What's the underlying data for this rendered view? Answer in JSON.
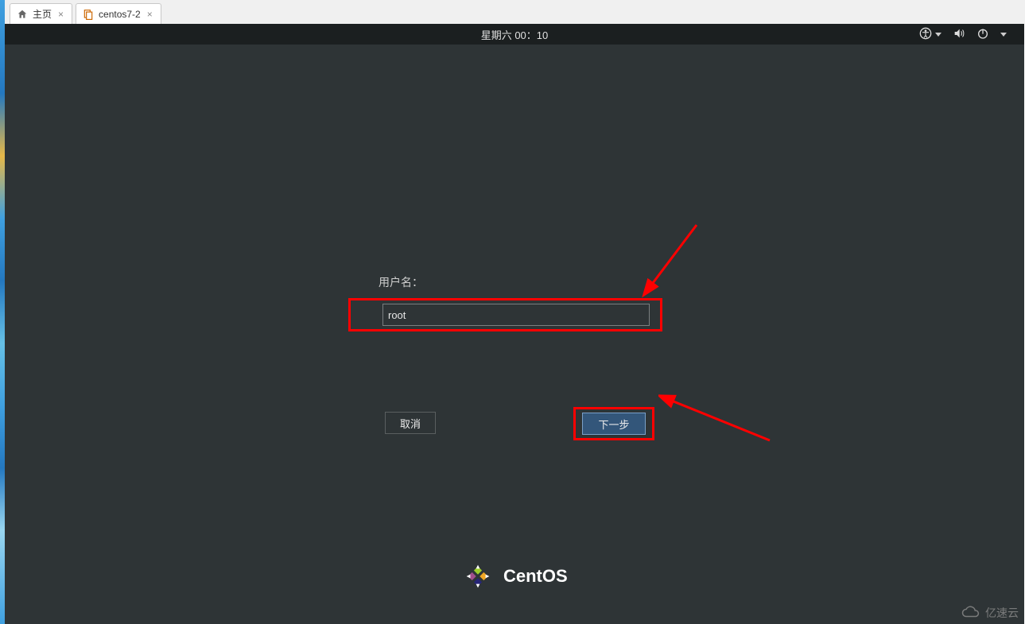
{
  "tabs": [
    {
      "label": "主页",
      "icon": "home"
    },
    {
      "label": "centos7-2",
      "icon": "doc"
    }
  ],
  "gnome": {
    "clock": "星期六 00：10"
  },
  "login": {
    "username_label": "用户名：",
    "username_value": "root",
    "cancel_label": "取消",
    "next_label": "下一步"
  },
  "os": {
    "name": "CentOS"
  },
  "watermark": {
    "text": "亿速云"
  }
}
